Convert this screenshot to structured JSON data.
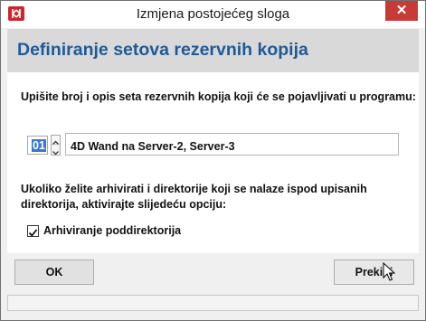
{
  "window": {
    "title": "Izmjena postojećeg sloga",
    "close_symbol": "✕"
  },
  "header": {
    "title": "Definiranje setova rezervnih kopija"
  },
  "content": {
    "instruction": "Upišite broj i opis seta rezervnih kopija koji će se pojavljivati u programu:",
    "set_number": "01",
    "set_description": "4D Wand na Server-2, Server-3",
    "archive_hint_line1": "Ukoliko želite arhivirati i direktorije koji se nalaze ispod upisanih",
    "archive_hint_line2": "direktorija, aktivirajte slijedeću opciju:",
    "subdir_checkbox_label": "Arhiviranje poddirektorija",
    "subdir_checked": true
  },
  "buttons": {
    "ok_label": "OK",
    "cancel_label": "Prekini"
  },
  "colors": {
    "header_title": "#1f5a96",
    "close_button": "#c83a35",
    "app_icon": "#cc2530",
    "selection": "#3878d0"
  },
  "icons": {
    "app": "app-icon",
    "close": "close-icon",
    "stepper_up": "chevron-up-icon",
    "stepper_down": "chevron-down-icon",
    "checkbox": "checkmark-icon",
    "cursor": "mouse-pointer-icon"
  }
}
